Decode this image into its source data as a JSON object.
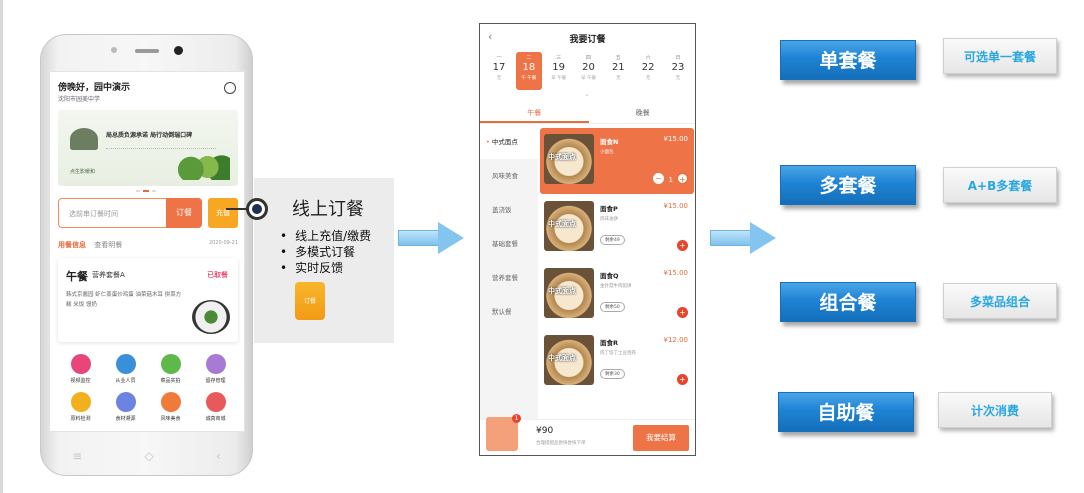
{
  "phone1": {
    "greeting": "傍晚好，园中演示",
    "school": "沈阳市园美中学",
    "banner_title": "局总质负源承诺 局行动倒瑞口碑",
    "banner_sign": "点生影暖和",
    "order_placeholder": "选前串订餐时间",
    "order_button": "订餐",
    "recharge_button": "充值",
    "tab_active": "用餐信息",
    "tab_other": "查看明餐",
    "date": "2020-09-21",
    "card_meal": "午餐",
    "card_package": "营养套餐A",
    "card_status": "已取餐",
    "card_desc": "韩式京酱园 虾仁蒸蛋炒鸡蛋 油菜菇木耳 拼菜方糕 米饭 馒奶",
    "grid": [
      {
        "label": "视频监控",
        "color": "#e8457a"
      },
      {
        "label": "从业人员",
        "color": "#3a8fd9"
      },
      {
        "label": "菜品实拍",
        "color": "#5fb84a"
      },
      {
        "label": "留存管理",
        "color": "#a77ad6"
      },
      {
        "label": "原料检测",
        "color": "#f2b01e"
      },
      {
        "label": "食材溯源",
        "color": "#6c84e0"
      },
      {
        "label": "风味美食",
        "color": "#f07a3a"
      },
      {
        "label": "诚真商城",
        "color": "#e85a5a"
      }
    ],
    "nav": [
      "≡",
      "◇",
      "‹"
    ]
  },
  "callout": {
    "title": "线上订餐",
    "bullets": [
      "线上充值/缴费",
      "多模式订餐",
      "实时反馈"
    ],
    "icon_label": "订餐"
  },
  "phone2": {
    "back": "‹",
    "title": "我要订餐",
    "days": [
      {
        "wd": "一",
        "dn": "17",
        "tag": "无"
      },
      {
        "wd": "二",
        "dn": "18",
        "tag": "午 午餐"
      },
      {
        "wd": "三",
        "dn": "19",
        "tag": "早 午餐"
      },
      {
        "wd": "四",
        "dn": "20",
        "tag": "早 午餐"
      },
      {
        "wd": "五",
        "dn": "21",
        "tag": "无"
      },
      {
        "wd": "六",
        "dn": "22",
        "tag": "无"
      },
      {
        "wd": "日",
        "dn": "23",
        "tag": "无"
      }
    ],
    "meal_tabs": [
      "午餐",
      "晚餐"
    ],
    "categories": [
      "中式面点",
      "风味美食",
      "盖浇饭",
      "基础套餐",
      "营养套餐",
      "默认餐"
    ],
    "items": [
      {
        "name": "面食N",
        "price": "¥15.00",
        "sub": "小面包",
        "remain": "",
        "qty": "1",
        "img": "中式面点"
      },
      {
        "name": "面食P",
        "price": "¥15.00",
        "sub": "风味油饼",
        "remain": "剩余49",
        "qty": "",
        "img": "中式面点"
      },
      {
        "name": "面食Q",
        "price": "¥15.00",
        "sub": "金针菇牛肉馅饼",
        "remain": "剩余50",
        "qty": "",
        "img": "中式面点"
      },
      {
        "name": "面食R",
        "price": "¥12.00",
        "sub": "肉丁馅丁土豆烧卷",
        "remain": "剩余30",
        "qty": "",
        "img": "中式面点"
      }
    ],
    "total": "¥90",
    "note": "合理搭配品尝快尝快下单",
    "settle": "我要结算"
  },
  "packages": [
    {
      "name": "单套餐",
      "tag": "可选单一套餐"
    },
    {
      "name": "多套餐",
      "tag": "A+B多套餐"
    },
    {
      "name": "组合餐",
      "tag": "多菜品组合"
    },
    {
      "name": "自助餐",
      "tag": "计次消费"
    }
  ]
}
